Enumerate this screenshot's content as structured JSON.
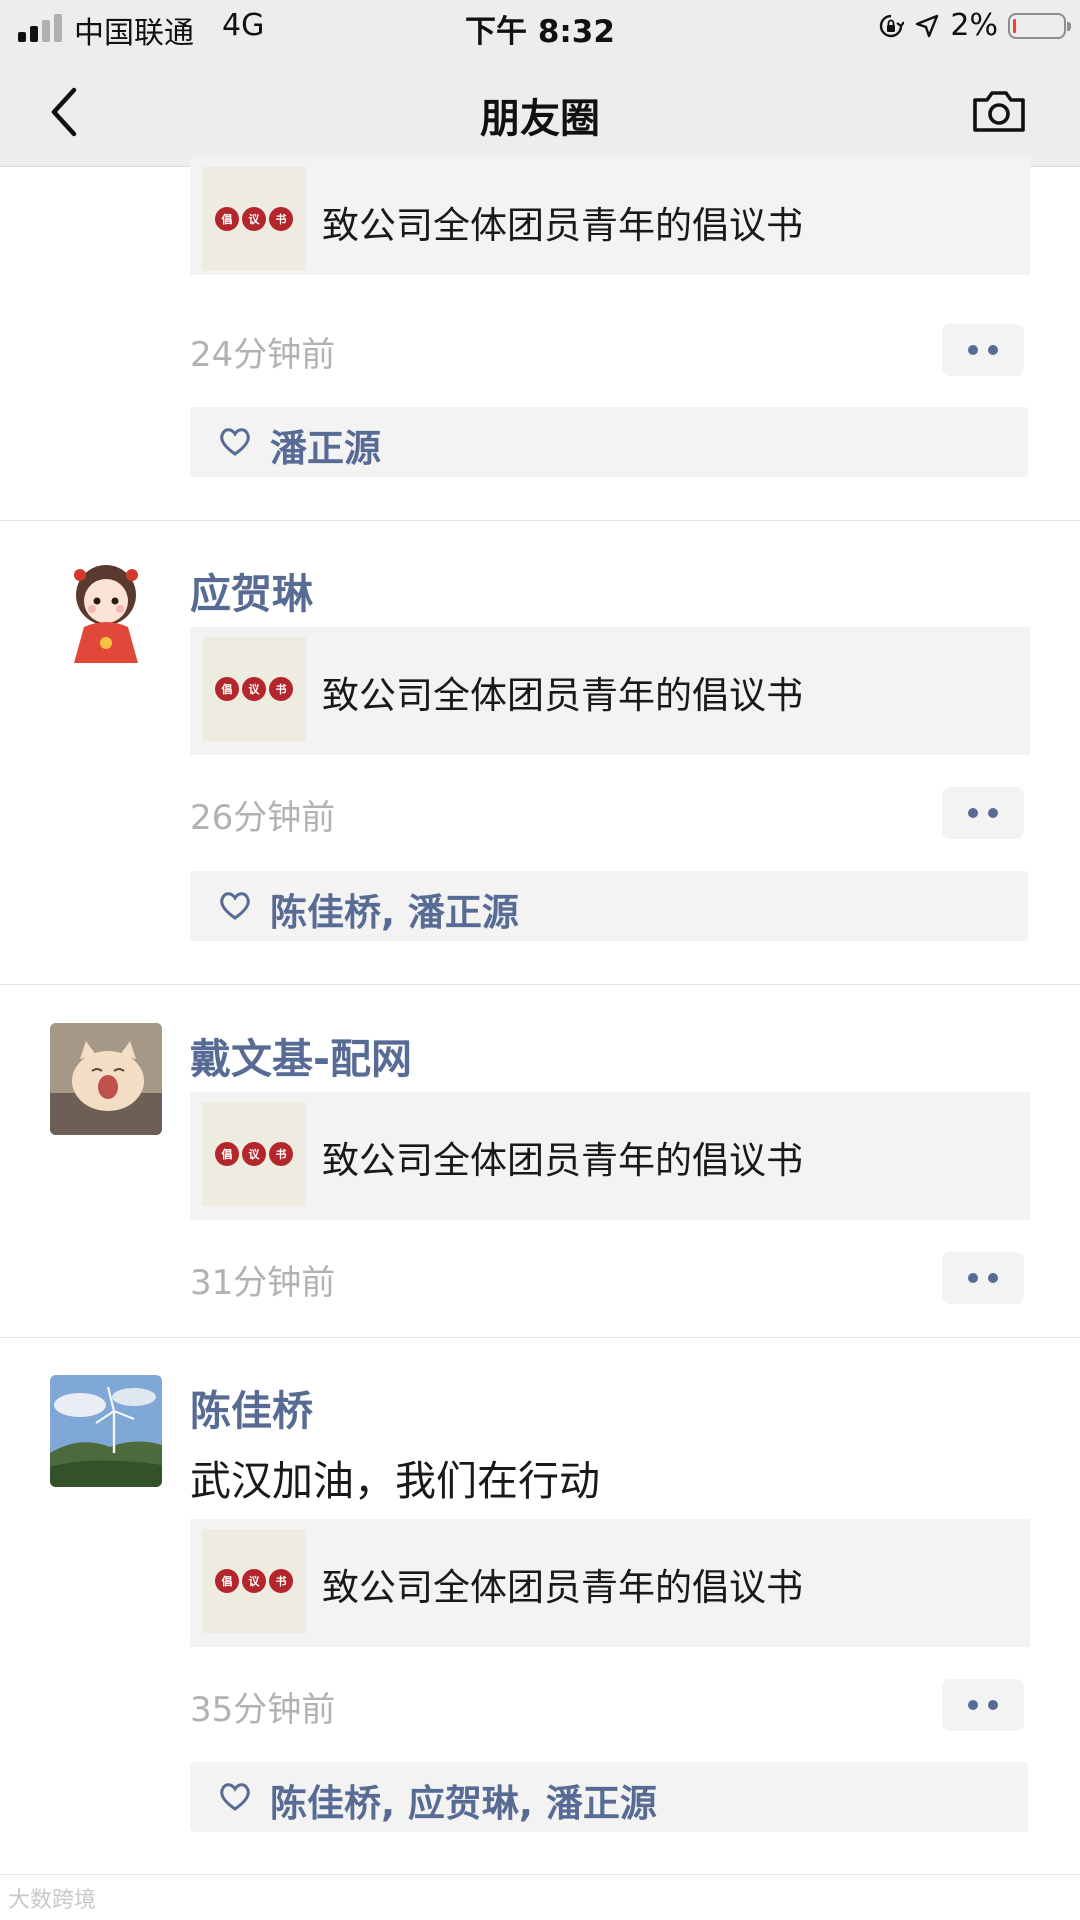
{
  "status_bar": {
    "carrier": "中国联通",
    "network": "4G",
    "time": "下午 8:32",
    "battery_percent": "2%",
    "signal_bars_filled": 2,
    "signal_bars_total": 4
  },
  "nav": {
    "title": "朋友圈",
    "back_icon": "chevron-left-icon",
    "camera_icon": "camera-icon"
  },
  "colors": {
    "name_blue": "#576b95",
    "time_gray": "#b2b2b2",
    "card_bg": "#f3f3f3",
    "nav_bg": "#ededed"
  },
  "link_badge": [
    "倡",
    "议",
    "书"
  ],
  "posts": [
    {
      "link_title": "致公司全体团员青年的倡议书",
      "time": "24分钟前",
      "likes": "潘正源"
    },
    {
      "name": "应贺琳",
      "link_title": "致公司全体团员青年的倡议书",
      "time": "26分钟前",
      "likes": "陈佳桥, 潘正源"
    },
    {
      "name": "戴文基-配网",
      "link_title": "致公司全体团员青年的倡议书",
      "time": "31分钟前"
    },
    {
      "name": "陈佳桥",
      "text": "武汉加油，我们在行动",
      "link_title": "致公司全体团员青年的倡议书",
      "time": "35分钟前",
      "likes": "陈佳桥, 应贺琳, 潘正源"
    }
  ],
  "watermark": "大数跨境"
}
